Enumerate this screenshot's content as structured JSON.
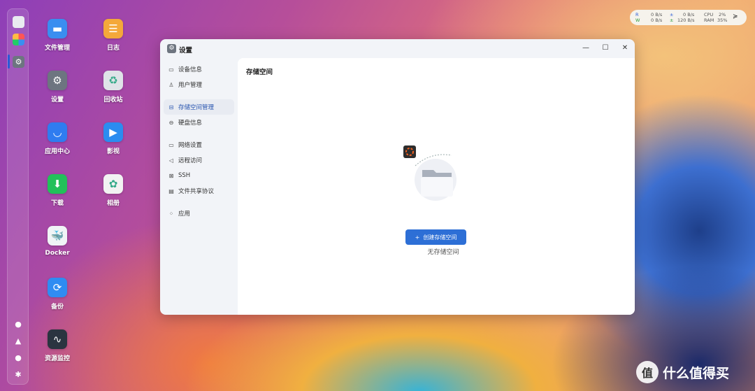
{
  "desktop": {
    "apps": [
      {
        "label": "文件管理",
        "icon": "folder-icon",
        "color": "#3a8ef0",
        "glyph": "▬"
      },
      {
        "label": "日志",
        "icon": "log-icon",
        "color": "#f4a83a",
        "glyph": "☰"
      },
      {
        "label": "设置",
        "icon": "gear-icon",
        "color": "#6d7580",
        "glyph": "⚙"
      },
      {
        "label": "回收站",
        "icon": "recycle-bin-icon",
        "color": "#dfe3e8",
        "glyph": "♻"
      },
      {
        "label": "应用中心",
        "icon": "store-icon",
        "color": "#2f7cf0",
        "glyph": "◡"
      },
      {
        "label": "影视",
        "icon": "video-icon",
        "color": "#2b8cf0",
        "glyph": "▶"
      },
      {
        "label": "下载",
        "icon": "download-icon",
        "color": "#22c05a",
        "glyph": "⬇"
      },
      {
        "label": "相册",
        "icon": "photos-icon",
        "color": "#f2f2f2",
        "glyph": "✿"
      },
      {
        "label": "Docker",
        "icon": "docker-icon",
        "color": "#f0f4f6",
        "glyph": "🐳"
      },
      {
        "label": "备份",
        "icon": "backup-icon",
        "color": "#2f8cf2",
        "glyph": "⟳"
      },
      {
        "label": "资源监控",
        "icon": "monitor-icon",
        "color": "#2a3440",
        "glyph": "∿"
      }
    ]
  },
  "monitor": {
    "r_label": "R",
    "w_label": "W",
    "r_down": "0 B/s",
    "w_down": "0 B/s",
    "r_up": "0 B/s",
    "w_up": "120 B/s",
    "cpu_label": "CPU",
    "ram_label": "RAM",
    "cpu": "2%",
    "ram": "35%",
    "up_arrow": "±"
  },
  "window": {
    "title": "设置",
    "minimize": "—",
    "maximize": "☐",
    "close": "✕",
    "nav": [
      {
        "label": "设备信息",
        "icon": "▭"
      },
      {
        "label": "用户管理",
        "icon": "♙"
      },
      {
        "label": "存储空间管理",
        "icon": "⊟"
      },
      {
        "label": "硬盘信息",
        "icon": "⊖"
      },
      {
        "label": "网络设置",
        "icon": "▭"
      },
      {
        "label": "远程访问",
        "icon": "◁"
      },
      {
        "label": "SSH",
        "icon": "⊠"
      },
      {
        "label": "文件共享协议",
        "icon": "▤"
      },
      {
        "label": "应用",
        "icon": "⁘"
      }
    ],
    "main": {
      "title": "存储空间",
      "empty_text": "无存储空间",
      "create_button": "创建存储空间",
      "plus": "+"
    }
  },
  "watermark": {
    "logo": "值",
    "text": "什么值得买"
  }
}
